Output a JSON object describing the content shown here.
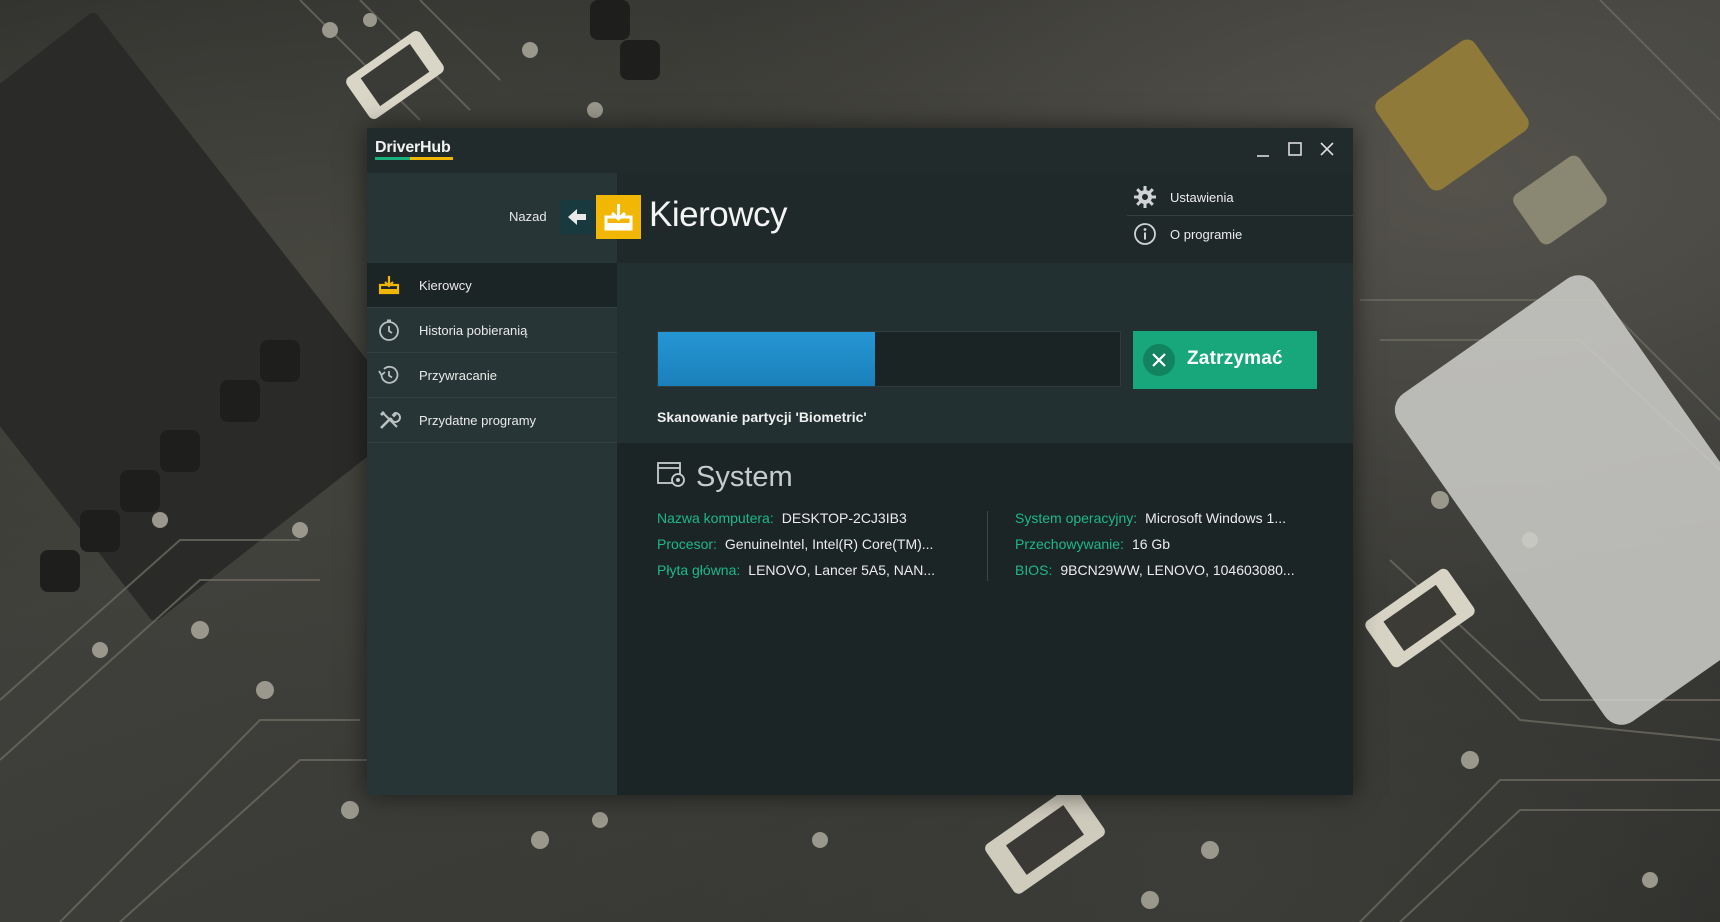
{
  "window": {
    "app_title": "DriverHub",
    "controls": {
      "minimize": "minimize-icon",
      "maximize": "maximize-icon",
      "close": "close-icon"
    }
  },
  "header": {
    "back_label": "Nazad",
    "title": "Kierowcy",
    "menu": [
      {
        "label": "Ustawienia",
        "icon": "gear-icon"
      },
      {
        "label": "O programie",
        "icon": "info-icon"
      }
    ]
  },
  "sidebar": {
    "items": [
      {
        "label": "Kierowcy",
        "icon": "drivers-tray-icon",
        "active": true
      },
      {
        "label": "Historia pobieranią",
        "icon": "clock-icon",
        "active": false
      },
      {
        "label": "Przywracanie",
        "icon": "history-icon",
        "active": false
      },
      {
        "label": "Przydatne programy",
        "icon": "tools-icon",
        "active": false
      }
    ]
  },
  "scan": {
    "progress_percent": 47,
    "stop_label": "Zatrzymać",
    "status": "Skanowanie partycji 'Biometric'"
  },
  "system": {
    "title": "System",
    "left": [
      {
        "key": "Nazwa komputera:",
        "value": "DESKTOP-2CJ3IB3"
      },
      {
        "key": "Procesor:",
        "value": "GenuineIntel, Intel(R) Core(TM)..."
      },
      {
        "key": "Płyta główna:",
        "value": "LENOVO, Lancer 5A5, NAN..."
      }
    ],
    "right": [
      {
        "key": "System operacyjny:",
        "value": "Microsoft Windows 1..."
      },
      {
        "key": "Przechowywanie:",
        "value": "16 Gb"
      },
      {
        "key": "BIOS:",
        "value": "9BCN29WW, LENOVO, 104603080..."
      }
    ]
  },
  "colors": {
    "accent_green": "#18a77a",
    "accent_yellow": "#f2b705",
    "progress_blue": "#2596d4",
    "label_green": "#1cb986"
  }
}
